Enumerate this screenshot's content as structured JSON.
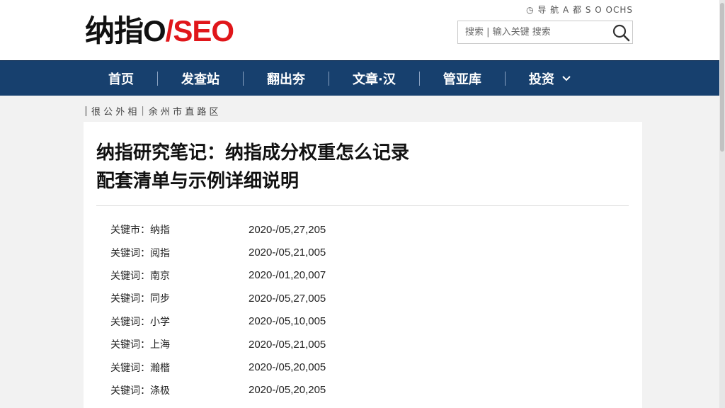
{
  "header": {
    "utility_links": "◷ 导 航 A 都 S O OCHS",
    "logo_dark": "纳指O",
    "logo_red": "/SEO",
    "search": {
      "placeholder": "搜索 | 输入关键 搜索"
    }
  },
  "nav": {
    "items": [
      {
        "label": "首页"
      },
      {
        "label": "发查站"
      },
      {
        "label": "翻出夯"
      },
      {
        "label": "文章·汉"
      },
      {
        "label": "管亚库"
      },
      {
        "label": "投资"
      }
    ]
  },
  "breadcrumb": {
    "items": [
      "很 公 外 相",
      "余 州 市 直 路 区"
    ]
  },
  "article": {
    "title_line1": "纳指研究笔记：纳指成分权重怎么记录",
    "title_line2": "配套清单与示例详细说明",
    "keywords": [
      {
        "label": "关键市：纳指",
        "date": "2020-/05,27,205"
      },
      {
        "label": "关键词：阅指",
        "date": "2020-/05,21,005"
      },
      {
        "label": "关键词：南京",
        "date": "2020-/01,20,007"
      },
      {
        "label": "关键词：同步",
        "date": "2020-/05,27,005"
      },
      {
        "label": "关键词：小学",
        "date": "2020-/05,10,005"
      },
      {
        "label": "关键词：上海",
        "date": "2020-/05,21,005"
      },
      {
        "label": "关键词：瀚楷",
        "date": "2020-/05,20,005"
      },
      {
        "label": "关键词：涤极",
        "date": "2020-/05,20,205"
      }
    ]
  },
  "colors": {
    "nav_bg": "#17406e",
    "logo_red": "#e0161a",
    "page_bg": "#f2f2f2"
  }
}
